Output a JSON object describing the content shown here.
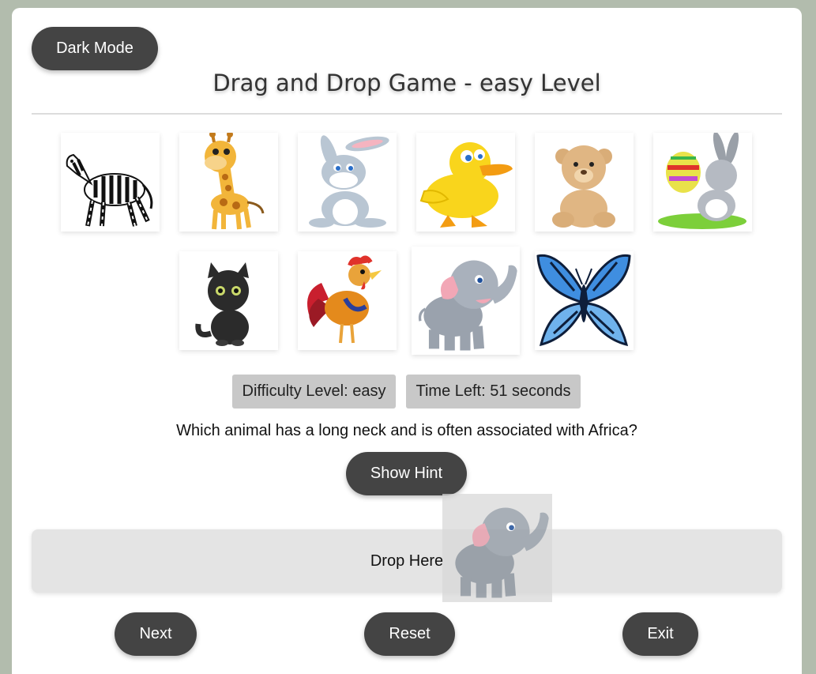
{
  "header": {
    "dark_mode_label": "Dark Mode",
    "title": "Drag and Drop Game - easy Level"
  },
  "animals": [
    {
      "name": "zebra",
      "icon": "zebra-icon"
    },
    {
      "name": "giraffe",
      "icon": "giraffe-icon"
    },
    {
      "name": "rabbit",
      "icon": "rabbit-icon"
    },
    {
      "name": "duck",
      "icon": "duck-icon"
    },
    {
      "name": "teddy bear",
      "icon": "teddy-bear-icon"
    },
    {
      "name": "easter bunny",
      "icon": "easter-bunny-icon"
    },
    {
      "name": "cat",
      "icon": "cat-icon"
    },
    {
      "name": "rooster",
      "icon": "rooster-icon"
    },
    {
      "name": "elephant",
      "icon": "elephant-icon"
    },
    {
      "name": "butterfly",
      "icon": "butterfly-icon"
    }
  ],
  "status": {
    "difficulty": "Difficulty Level: easy",
    "time_left": "Time Left: 51 seconds"
  },
  "question": "Which animal has a long neck and is often associated with Africa?",
  "buttons": {
    "hint": "Show Hint",
    "next": "Next",
    "reset": "Reset",
    "exit": "Exit"
  },
  "dropzone": {
    "label": "Drop Here",
    "dragging_item": "elephant"
  },
  "colors": {
    "background": "#b2bcad",
    "button": "#444444",
    "badge": "#c8c8c8",
    "dropzone": "#e4e4e4"
  }
}
